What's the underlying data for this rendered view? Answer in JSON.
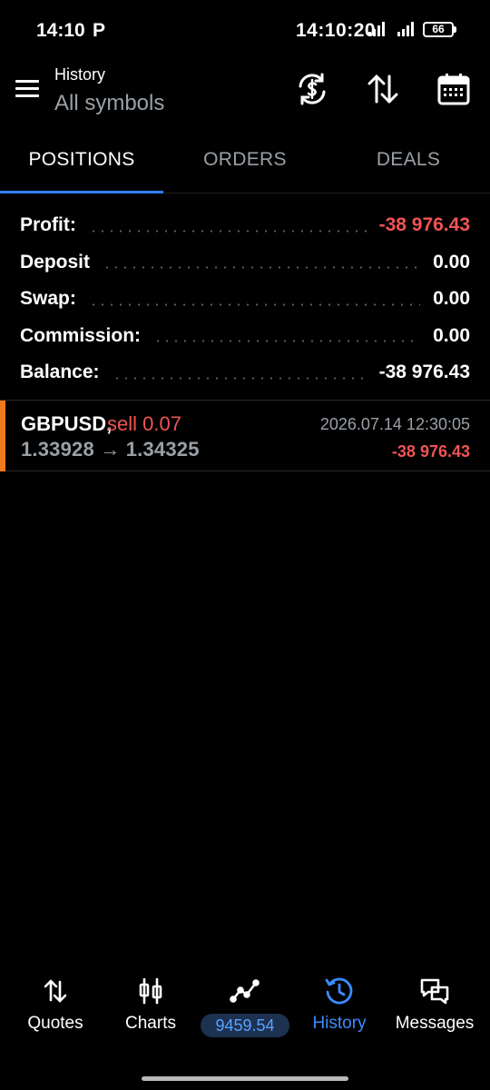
{
  "status_bar": {
    "time": "14:10",
    "carrier_icon": "P",
    "time_overlay": "14:10:20",
    "battery": "66"
  },
  "app_bar": {
    "title": "History",
    "subtitle": "All symbols",
    "icons": [
      "menu-icon",
      "refresh-currency-icon",
      "sort-icon",
      "calendar-icon"
    ]
  },
  "tabs": [
    {
      "label": "POSITIONS",
      "active": true
    },
    {
      "label": "ORDERS",
      "active": false
    },
    {
      "label": "DEALS",
      "active": false
    }
  ],
  "summary": {
    "profit_label": "Profit:",
    "profit_value": "-38 976.43",
    "deposit_label": "Deposit",
    "deposit_value": "0.00",
    "swap_label": "Swap:",
    "swap_value": "0.00",
    "commission_label": "Commission:",
    "commission_value": "0.00",
    "balance_label": "Balance:",
    "balance_value": "-38 976.43"
  },
  "deals": [
    {
      "symbol": "GBPUSD,",
      "type": "sell 0.07",
      "prices": "1.33928 → 1.34325",
      "time": "2026.07.14 12:30:05",
      "profit": "-38 976.43"
    }
  ],
  "bottom_nav": {
    "quotes": "Quotes",
    "charts": "Charts",
    "balance": "9459.54",
    "history": "History",
    "messages": "Messages"
  },
  "colors": {
    "accent": "#2f7ff6",
    "negative": "#f05454",
    "position_bar": "#f07a1a"
  }
}
